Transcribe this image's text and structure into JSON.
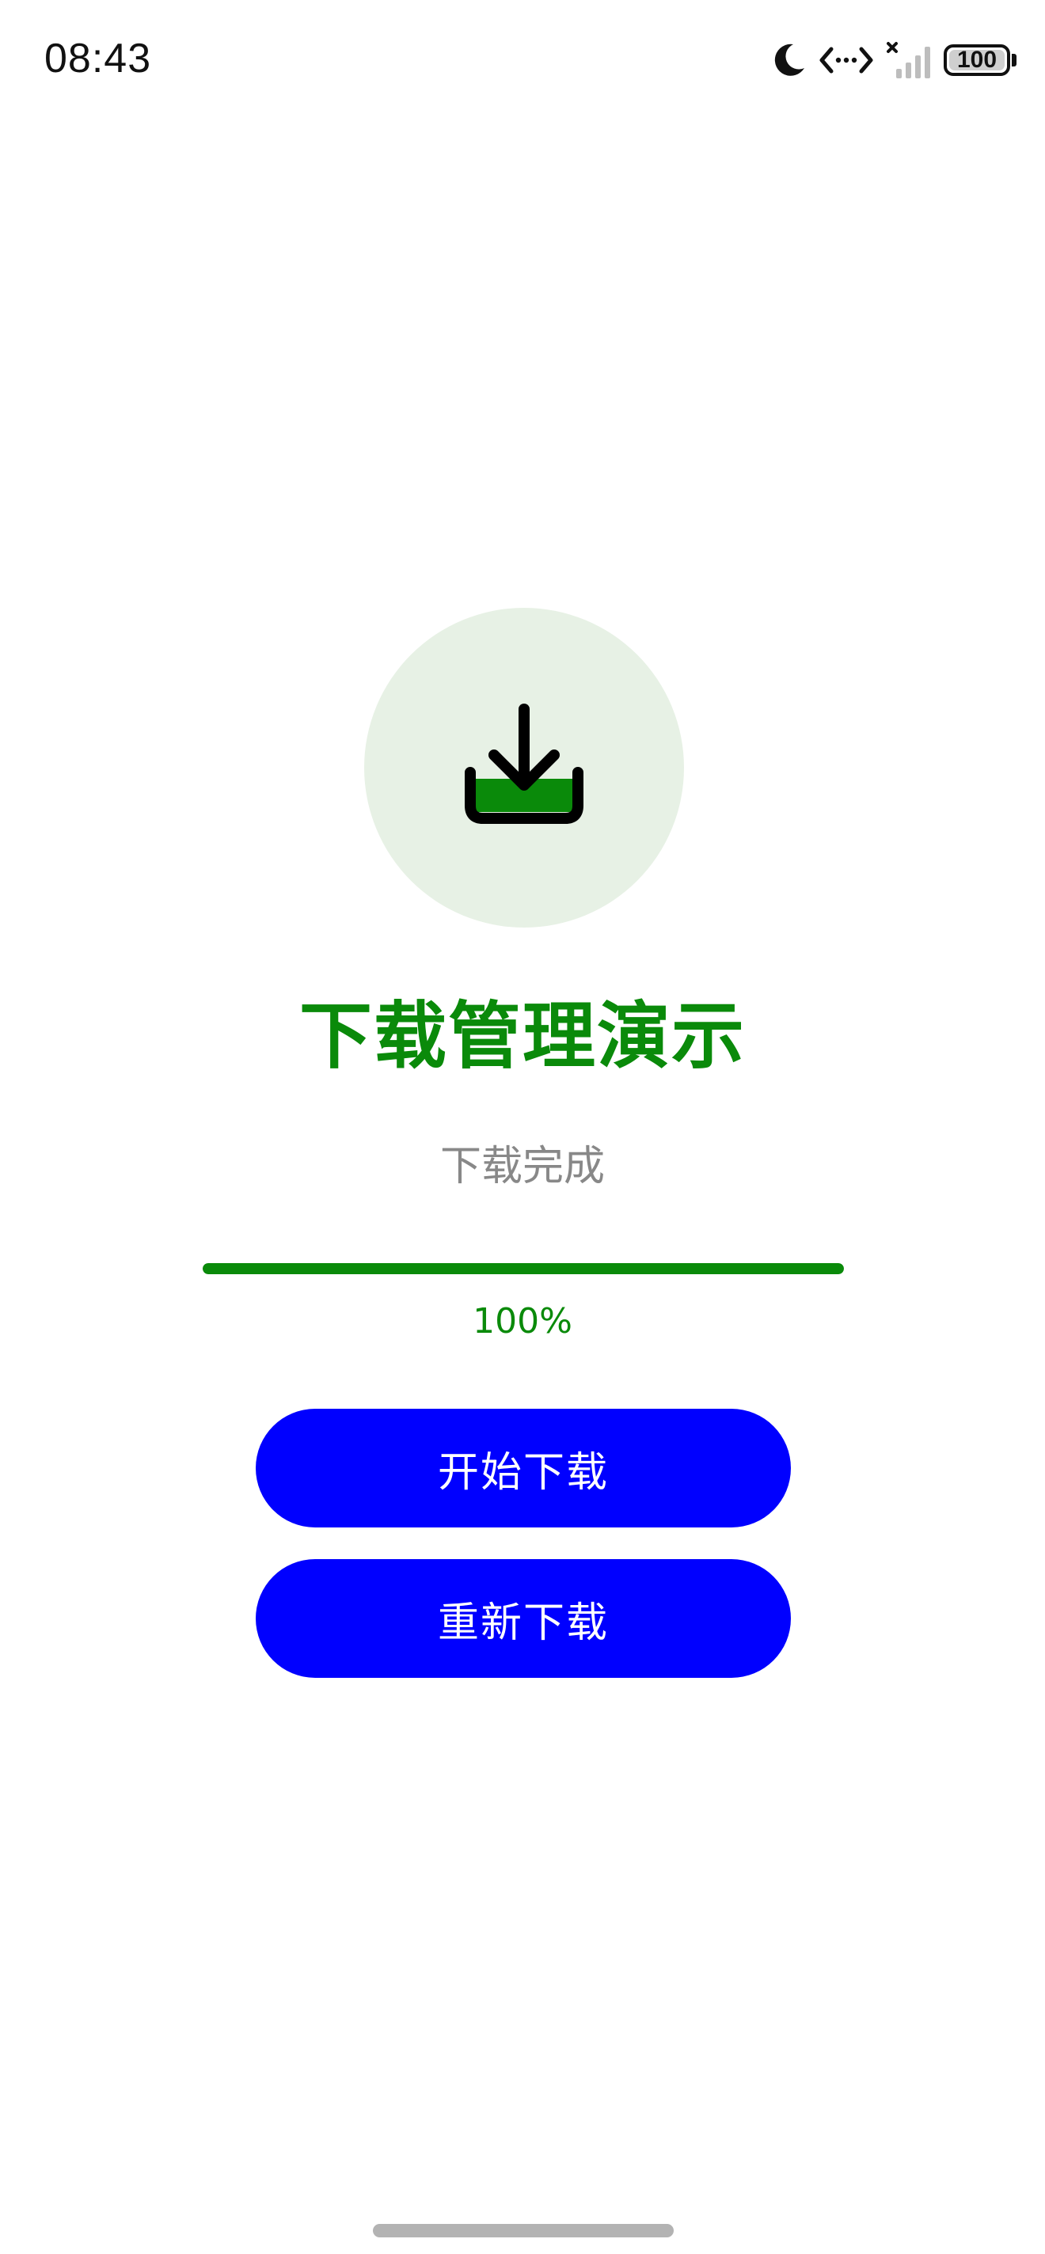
{
  "status_bar": {
    "time": "08:43",
    "battery_level": 100,
    "battery_text": "100",
    "icons": [
      "moon-icon",
      "data-transfer-icon",
      "cellular-signal-no-sim-icon",
      "battery-icon"
    ]
  },
  "main": {
    "hero_icon": "download-tray-icon",
    "title": "下载管理演示",
    "status": "下载完成",
    "progress_fraction": 1.0,
    "progress_text": "100%",
    "buttons": {
      "start": "开始下载",
      "restart": "重新下载"
    }
  },
  "colors": {
    "accent_green": "#0a8a0a",
    "circle_bg": "#e7f1e5",
    "button_blue": "#0000ff",
    "status_gray": "#888888"
  }
}
